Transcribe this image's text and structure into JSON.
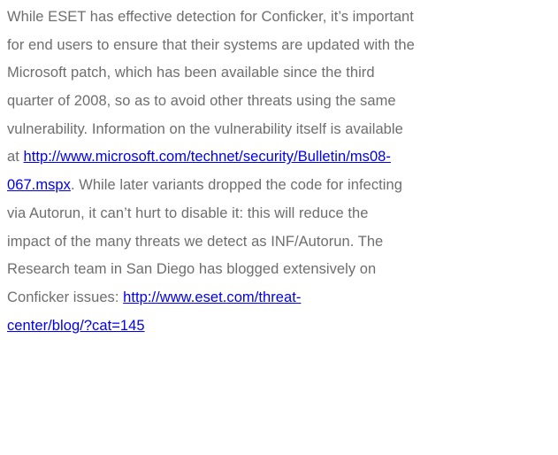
{
  "document": {
    "lines": [
      {
        "text": "While ESET has effective detection for Conficker, it’s important"
      },
      {
        "text": "for end users to ensure that their systems are updated with the"
      },
      {
        "text": "Microsoft patch, which has been available since the third"
      },
      {
        "text": "quarter of 2008, so as to avoid other threats using the same"
      },
      {
        "text": "vulnerability. Information on the vulnerability itself is available"
      },
      {
        "prefix": "at ",
        "link": "http://www.microsoft.com/technet/security/Bulletin/ms08-"
      },
      {
        "link": "067.mspx",
        "suffix": ". While later variants dropped the code for infecting"
      },
      {
        "text": "via Autorun, it can’t hurt to disable it: this will reduce the"
      },
      {
        "text": "impact of the many threats we detect as INF/Autorun. The"
      },
      {
        "text": "Research team in San Diego has blogged extensively on"
      },
      {
        "prefix": "Conficker issues: ",
        "link": "http://www.eset.com/threat-"
      },
      {
        "link": "center/blog/?cat=145"
      }
    ]
  }
}
